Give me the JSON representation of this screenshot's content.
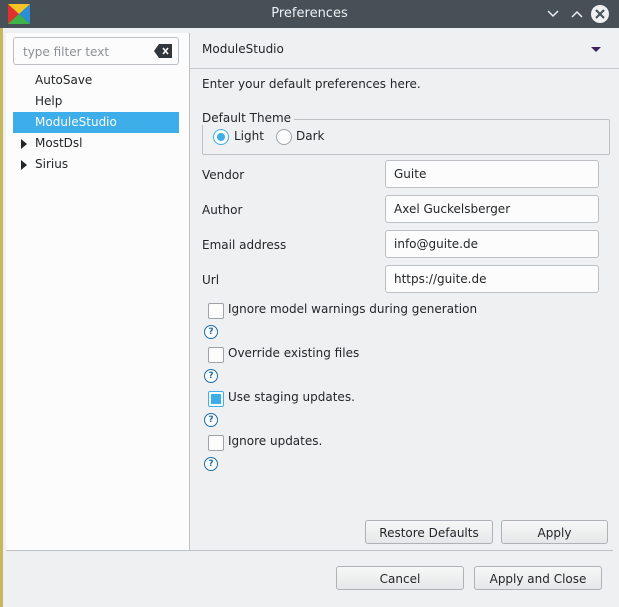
{
  "window": {
    "title": "Preferences"
  },
  "filter": {
    "placeholder": "type filter text"
  },
  "tree": {
    "items": [
      {
        "label": "AutoSave"
      },
      {
        "label": "Help"
      },
      {
        "label": "ModuleStudio",
        "selected": true
      },
      {
        "label": "MostDsl",
        "expandable": true
      },
      {
        "label": "Sirius",
        "expandable": true
      }
    ]
  },
  "page": {
    "title": "ModuleStudio",
    "description": "Enter your default preferences here.",
    "theme": {
      "legend": "Default Theme",
      "options": [
        {
          "label": "Light",
          "checked": true
        },
        {
          "label": "Dark",
          "checked": false
        }
      ]
    },
    "fields": [
      {
        "label": "Vendor",
        "value": "Guite"
      },
      {
        "label": "Author",
        "value": "Axel Guckelsberger"
      },
      {
        "label": "Email address",
        "value": "info@guite.de"
      },
      {
        "label": "Url",
        "value": "https://guite.de"
      }
    ],
    "checks": [
      {
        "label": "Ignore model warnings during generation",
        "checked": false,
        "help": "?"
      },
      {
        "label": "Override existing files",
        "checked": false,
        "help": "?"
      },
      {
        "label": "Use staging updates.",
        "checked": true,
        "help": "?"
      },
      {
        "label": "Ignore updates.",
        "checked": false,
        "help": "?"
      }
    ],
    "restore_label": "Restore Defaults",
    "apply_label": "Apply"
  },
  "dialog": {
    "cancel_label": "Cancel",
    "apply_close_label": "Apply and Close"
  },
  "icons": {
    "app": "modulestudio-logo-icon",
    "minimize": "chevron-down-icon",
    "maximize": "chevron-up-icon",
    "close": "close-icon",
    "clear": "clear-text-icon",
    "help": "help-icon",
    "page_menu": "view-menu-icon"
  },
  "colors": {
    "selection": "#3daee9",
    "titlebar": "#475057",
    "help": "#1d6ca8"
  }
}
